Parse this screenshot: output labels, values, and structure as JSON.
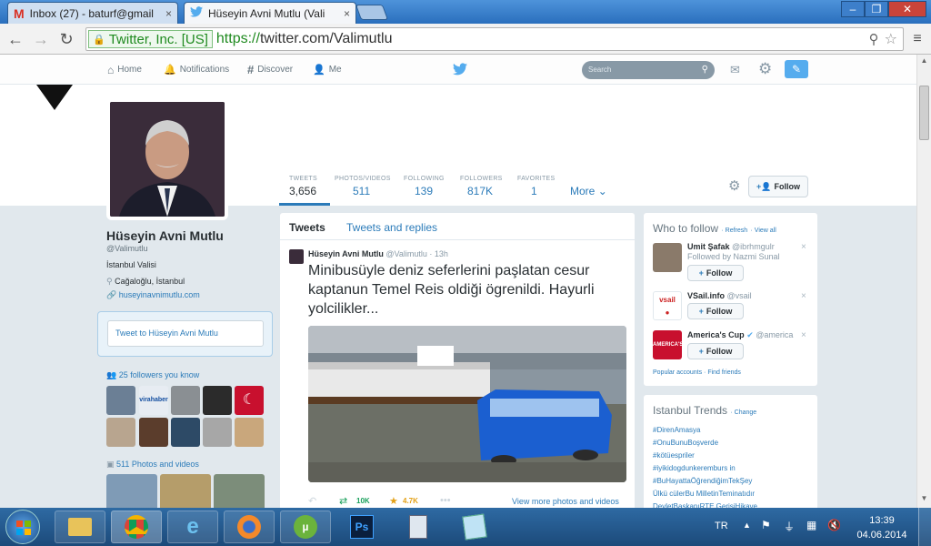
{
  "browser": {
    "tabs": [
      {
        "title": "Inbox (27) - baturf@gmail",
        "icon": "gmail-icon"
      },
      {
        "title": "Hüseyin Avni Mutlu (Vali",
        "icon": "twitter-bird-icon"
      }
    ],
    "ssl_label": "Twitter, Inc. [US]",
    "url_protocol": "https://",
    "url_rest": "twitter.com/Valimutlu"
  },
  "twnav": {
    "home": "Home",
    "notifications": "Notifications",
    "discover": "Discover",
    "me": "Me",
    "search_placeholder": "Search"
  },
  "profile": {
    "name": "Hüseyin Avni Mutlu",
    "handle": "@Valimutlu",
    "bio": "İstanbul Valisi",
    "location": "Cağaloğlu, İstanbul",
    "website": "huseyinavnimutlu.com",
    "tweet_to": "Tweet to Hüseyin Avni Mutlu",
    "followers_you_know": "25 followers you know",
    "photos_videos": "511 Photos and videos"
  },
  "stats": [
    {
      "label": "TWEETS",
      "value": "3,656"
    },
    {
      "label": "PHOTOS/VIDEOS",
      "value": "511"
    },
    {
      "label": "FOLLOWING",
      "value": "139"
    },
    {
      "label": "FOLLOWERS",
      "value": "817K"
    },
    {
      "label": "FAVORITES",
      "value": "1"
    }
  ],
  "more_label": "More",
  "follow_label": "Follow",
  "timeline": {
    "tab_tweets": "Tweets",
    "tab_replies": "Tweets and replies",
    "tweet": {
      "author": "Hüseyin Avni Mutlu",
      "handle": "@Valimutlu",
      "time": "· 13h",
      "text": "Minibusüyle deniz seferlerini paşlatan cesur kaptanun Temel Reis oldiği ögrenildi. Hayurli yolcilikler...",
      "retweets": "10K",
      "favorites": "4.7K",
      "view_more": "View more photos and videos"
    }
  },
  "who_to_follow": {
    "title": "Who to follow",
    "refresh": "· Refresh",
    "view_all": "· View all",
    "people": [
      {
        "name": "Umit Şafak",
        "handle": "@ibrhmgulr",
        "sub": "Followed by Nazmi Sunal"
      },
      {
        "name": "VSail.info",
        "handle": "@vsail",
        "sub": ""
      },
      {
        "name": "America's Cup",
        "handle": "@america",
        "sub": ""
      }
    ],
    "popular": "Popular accounts",
    "find_friends": "· Find friends"
  },
  "trends": {
    "title": "Istanbul Trends",
    "change": "· Change",
    "items": [
      "#DirenAmasya",
      "#OnuBunuBoşverde",
      "#kötüespriler",
      "#iyikidogdunkeremburs in",
      "#BuHayattaÖğrendiğimTekŞey",
      "Ülkü cülerBu MilletinTeminatıdır",
      "DevletBaşkanıRTE GerisiHikaye"
    ]
  },
  "taskbar": {
    "lang": "TR",
    "time": "13:39",
    "date": "04.06.2014"
  },
  "colors": {
    "twitter_blue": "#2b7bb9",
    "retweet_green": "#19a05b",
    "favorite_gold": "#e3a016"
  }
}
